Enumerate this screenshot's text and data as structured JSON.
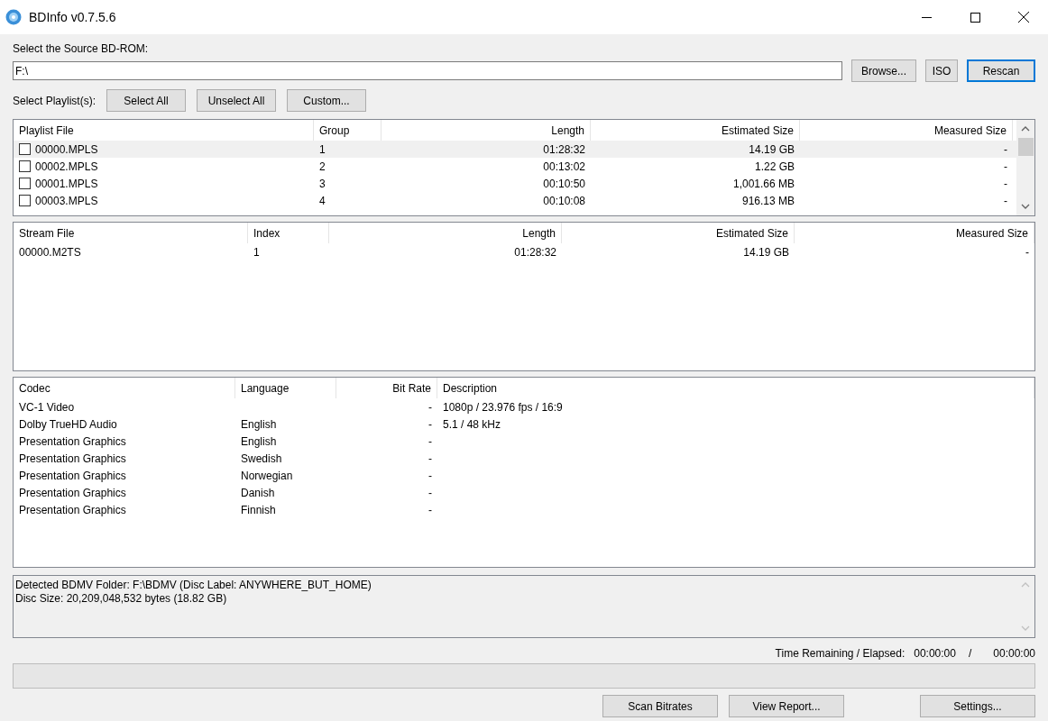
{
  "window": {
    "title": "BDInfo v0.7.5.6"
  },
  "source": {
    "label": "Select the Source BD-ROM:",
    "value": "F:\\",
    "buttons": [
      {
        "label": "Browse...",
        "focused": false
      },
      {
        "label": "ISO",
        "focused": false
      },
      {
        "label": "Rescan",
        "focused": true
      }
    ]
  },
  "playlist_select": {
    "label": "Select Playlist(s):",
    "buttons": [
      "Select All",
      "Unselect All",
      "Custom..."
    ]
  },
  "playlists": {
    "columns": [
      {
        "label": "Playlist File",
        "right_aligned": false
      },
      {
        "label": "Group",
        "right_aligned": false
      },
      {
        "label": "Length",
        "right_aligned": true
      },
      {
        "label": "Estimated Size",
        "right_aligned": true
      },
      {
        "label": "Measured Size",
        "right_aligned": true
      }
    ],
    "rows": [
      {
        "selected": true,
        "checked": false,
        "cells": [
          "00000.MPLS",
          "1",
          "01:28:32",
          "14.19 GB",
          "-"
        ]
      },
      {
        "selected": false,
        "checked": false,
        "cells": [
          "00002.MPLS",
          "2",
          "00:13:02",
          "1.22 GB",
          "-"
        ]
      },
      {
        "selected": false,
        "checked": false,
        "cells": [
          "00001.MPLS",
          "3",
          "00:10:50",
          "1,001.66 MB",
          "-"
        ]
      },
      {
        "selected": false,
        "checked": false,
        "cells": [
          "00003.MPLS",
          "4",
          "00:10:08",
          "916.13 MB",
          "-"
        ]
      }
    ]
  },
  "streams": {
    "columns": [
      {
        "label": "Stream File",
        "right_aligned": false
      },
      {
        "label": "Index",
        "right_aligned": false
      },
      {
        "label": "Length",
        "right_aligned": true
      },
      {
        "label": "Estimated Size",
        "right_aligned": true
      },
      {
        "label": "Measured Size",
        "right_aligned": true
      }
    ],
    "rows": [
      {
        "cells": [
          "00000.M2TS",
          "1",
          "01:28:32",
          "14.19 GB",
          "-"
        ]
      }
    ]
  },
  "codecs": {
    "columns": [
      {
        "label": "Codec",
        "right_aligned": false
      },
      {
        "label": "Language",
        "right_aligned": false
      },
      {
        "label": "Bit Rate",
        "right_aligned": true
      },
      {
        "label": "Description",
        "right_aligned": false
      }
    ],
    "rows": [
      {
        "cells": [
          "VC-1 Video",
          "",
          "-",
          "1080p / 23.976 fps / 16:9"
        ]
      },
      {
        "cells": [
          "Dolby TrueHD Audio",
          "English",
          "-",
          "5.1 / 48 kHz"
        ]
      },
      {
        "cells": [
          "Presentation Graphics",
          "English",
          "-",
          ""
        ]
      },
      {
        "cells": [
          "Presentation Graphics",
          "Swedish",
          "-",
          ""
        ]
      },
      {
        "cells": [
          "Presentation Graphics",
          "Norwegian",
          "-",
          ""
        ]
      },
      {
        "cells": [
          "Presentation Graphics",
          "Danish",
          "-",
          ""
        ]
      },
      {
        "cells": [
          "Presentation Graphics",
          "Finnish",
          "-",
          ""
        ]
      }
    ]
  },
  "info": [
    "Detected BDMV Folder: F:\\BDMV (Disc Label: ANYWHERE_BUT_HOME)",
    "Disc Size: 20,209,048,532 bytes (18.82 GB)"
  ],
  "time": {
    "label": "Time Remaining / Elapsed:",
    "remaining": "00:00:00",
    "separator": "/",
    "elapsed": "00:00:00"
  },
  "progress": {
    "level": 0
  },
  "buttons": [
    "Scan Bitrates",
    "View Report...",
    "Settings..."
  ]
}
